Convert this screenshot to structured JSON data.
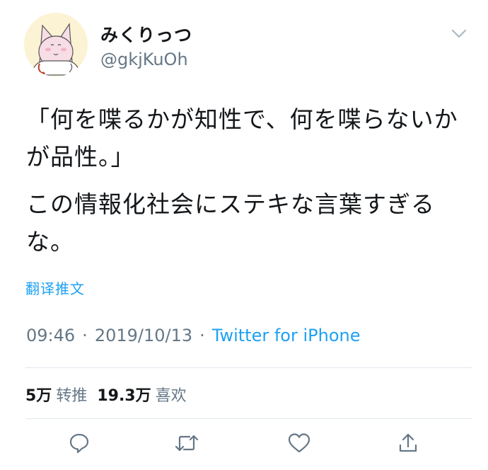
{
  "user": {
    "display_name": "みくりっつ",
    "handle": "@gkjKuOh"
  },
  "tweet": {
    "paragraph1": "「何を喋るかが知性で、何を喋らないかが品性。」",
    "paragraph2": "この情報化社会にステキな言葉すぎるな。",
    "translate_label": "翻译推文"
  },
  "meta": {
    "time": "09:46",
    "separator": "·",
    "date": "2019/10/13",
    "source": "Twitter for iPhone"
  },
  "stats": {
    "retweets_count": "5万",
    "retweets_label": "转推",
    "likes_count": "19.3万",
    "likes_label": "喜欢"
  },
  "icons": {
    "menu": "chevron-down-icon",
    "reply": "reply-icon",
    "retweet": "retweet-icon",
    "like": "heart-icon",
    "share": "share-icon"
  },
  "colors": {
    "accent": "#1da1f2",
    "secondary_text": "#657786",
    "primary_text": "#14171a",
    "divider": "#e1e8ed"
  }
}
